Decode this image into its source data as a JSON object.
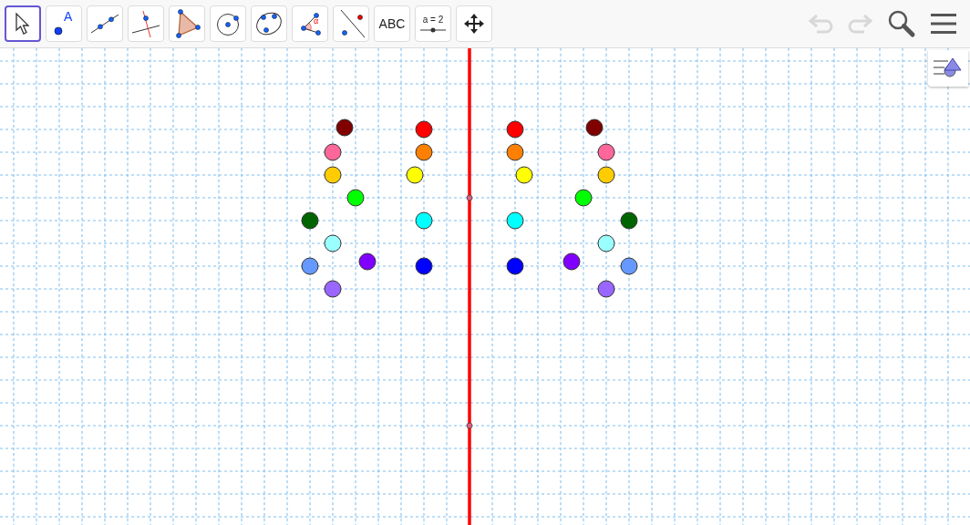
{
  "toolbar": {
    "tools": [
      {
        "kind": "move",
        "selected": true
      },
      {
        "kind": "point",
        "label": "A",
        "selected": false
      },
      {
        "kind": "line",
        "selected": false
      },
      {
        "kind": "perpendicular",
        "selected": false
      },
      {
        "kind": "polygon",
        "selected": false
      },
      {
        "kind": "circle",
        "selected": false
      },
      {
        "kind": "ellipse",
        "selected": false
      },
      {
        "kind": "angle",
        "label": "α",
        "selected": false
      },
      {
        "kind": "reflect",
        "selected": false
      },
      {
        "kind": "text",
        "label": "ABC",
        "selected": false
      },
      {
        "kind": "slider",
        "label": "a = 2",
        "selected": false
      },
      {
        "kind": "pan",
        "selected": false
      }
    ],
    "undo": {
      "disabled": true
    },
    "redo": {
      "disabled": true
    }
  },
  "canvas": {
    "points": [
      {
        "color": "#800000"
      },
      {
        "color": "#ff6699"
      },
      {
        "color": "#ffcc00"
      },
      {
        "color": "#00ff00"
      },
      {
        "color": "#006400"
      },
      {
        "color": "#99ffff"
      },
      {
        "color": "#8000ff"
      },
      {
        "color": "#6699ff"
      },
      {
        "color": "#9966ff"
      },
      {
        "color": "#ff0000"
      },
      {
        "color": "#ff8000"
      },
      {
        "color": "#ffff00"
      },
      {
        "color": "#00ffff"
      },
      {
        "color": "#0000ff"
      }
    ],
    "mirrored_points": [
      {
        "color": "#800000"
      },
      {
        "color": "#ff6699"
      },
      {
        "color": "#ffcc00"
      },
      {
        "color": "#00ff00"
      },
      {
        "color": "#006400"
      },
      {
        "color": "#99ffff"
      },
      {
        "color": "#8000ff"
      },
      {
        "color": "#6699ff"
      },
      {
        "color": "#9966ff"
      },
      {
        "color": "#ff0000"
      },
      {
        "color": "#ff8000"
      },
      {
        "color": "#ffff00"
      },
      {
        "color": "#00ffff"
      },
      {
        "color": "#0000ff"
      }
    ]
  }
}
